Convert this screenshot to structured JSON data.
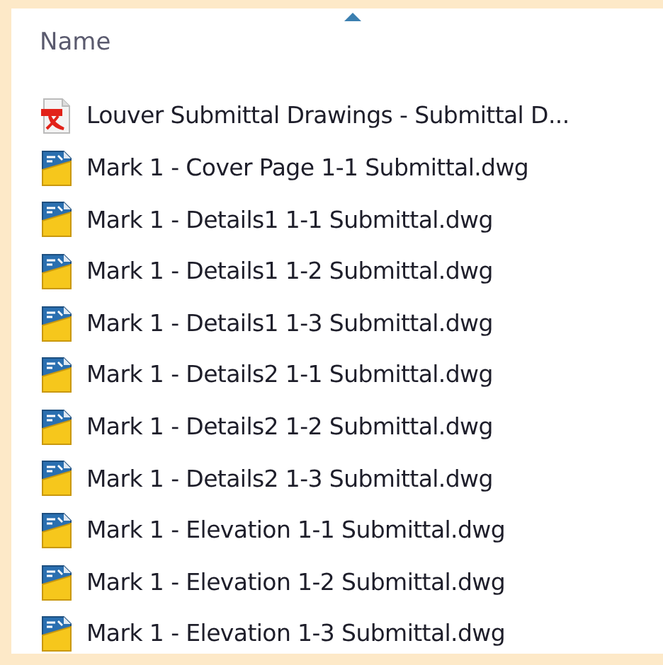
{
  "columns": [
    {
      "label": "Name",
      "sorted": true
    }
  ],
  "files": [
    {
      "kind": "pdf",
      "name": "Louver Submittal Drawings - Submittal D..."
    },
    {
      "kind": "dwg",
      "name": "Mark 1 - Cover Page 1-1 Submittal.dwg"
    },
    {
      "kind": "dwg",
      "name": "Mark 1 - Details1 1-1 Submittal.dwg"
    },
    {
      "kind": "dwg",
      "name": "Mark 1 - Details1 1-2 Submittal.dwg"
    },
    {
      "kind": "dwg",
      "name": "Mark 1 - Details1 1-3 Submittal.dwg"
    },
    {
      "kind": "dwg",
      "name": "Mark 1 - Details2 1-1 Submittal.dwg"
    },
    {
      "kind": "dwg",
      "name": "Mark 1 - Details2 1-2 Submittal.dwg"
    },
    {
      "kind": "dwg",
      "name": "Mark 1 - Details2 1-3 Submittal.dwg"
    },
    {
      "kind": "dwg",
      "name": "Mark 1 - Elevation 1-1 Submittal.dwg"
    },
    {
      "kind": "dwg",
      "name": "Mark 1 - Elevation 1-2 Submittal.dwg"
    },
    {
      "kind": "dwg",
      "name": "Mark 1 - Elevation 1-3 Submittal.dwg"
    }
  ]
}
